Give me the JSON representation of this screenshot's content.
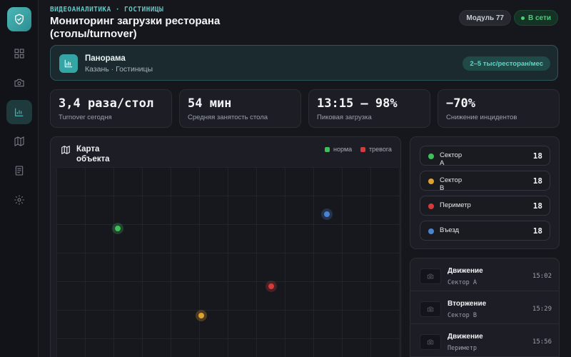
{
  "header": {
    "eyebrow": "ВИДЕОАНАЛИТИКА · ГОСТИНИЦЫ",
    "title": "Мониторинг загрузки ресторана (столы/turnover)",
    "module": "Модуль 77",
    "status": "В сети"
  },
  "sidebar": {
    "logo_icon": "shield-check-icon",
    "items": [
      {
        "icon": "dashboard-icon",
        "active": false
      },
      {
        "icon": "camera-icon",
        "active": false
      },
      {
        "icon": "chart-icon",
        "active": true
      },
      {
        "icon": "map-icon",
        "active": false
      },
      {
        "icon": "document-icon",
        "active": false
      },
      {
        "icon": "settings-icon",
        "active": false
      }
    ]
  },
  "banner": {
    "title": "Панорама",
    "subtitle": "Казань · Гостиницы",
    "badge": "2–5 тыс/ресторан/мес"
  },
  "stats": [
    {
      "value": "3,4 раза/стол",
      "label": "Turnover сегодня"
    },
    {
      "value": "54 мин",
      "label": "Средняя занятость стола"
    },
    {
      "value": "13:15 — 98%",
      "label": "Пиковая загрузка"
    },
    {
      "value": "−70%",
      "label": "Снижение инцидентов"
    }
  ],
  "map": {
    "title": "Карта объекта",
    "legend": [
      {
        "label": "норма",
        "color": "#3fbf5a"
      },
      {
        "label": "тревога",
        "color": "#d63a3a"
      }
    ],
    "marker_colors": {
      "green": "#3fbf5a",
      "blue": "#4a84d0",
      "red": "#d63a3a",
      "orange": "#e0a12e"
    }
  },
  "sectors": [
    {
      "name": "Сектор А",
      "count": "18",
      "color": "#3fbf5a"
    },
    {
      "name": "Сектор В",
      "count": "18",
      "color": "#e0a12e"
    },
    {
      "name": "Периметр",
      "count": "18",
      "color": "#d63a3a"
    },
    {
      "name": "Въезд",
      "count": "18",
      "color": "#4a84d0"
    }
  ],
  "events": [
    {
      "title": "Движение",
      "sub": "Сектор А",
      "time": "15:02"
    },
    {
      "title": "Вторжение",
      "sub": "Сектор В",
      "time": "15:29"
    },
    {
      "title": "Движение",
      "sub": "Периметр",
      "time": "15:56"
    }
  ],
  "colors": {
    "accent": "#4fc2c2",
    "online": "#45d07a"
  }
}
